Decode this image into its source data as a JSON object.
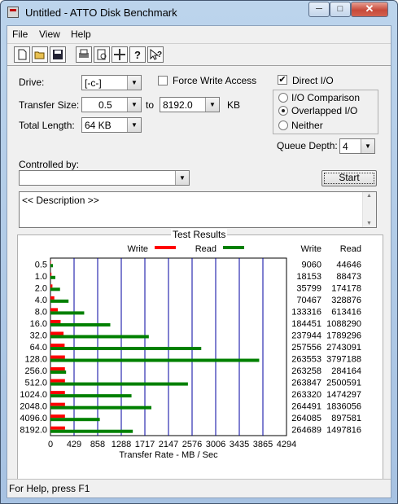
{
  "window": {
    "title": "Untitled - ATTO Disk Benchmark"
  },
  "titlebar": {
    "min_glyph": "─",
    "max_glyph": "□",
    "close_glyph": "✕"
  },
  "menu": [
    "File",
    "View",
    "Help"
  ],
  "toolbar_icons": [
    "new-document-icon",
    "open-folder-icon",
    "save-icon",
    "print-icon",
    "print-preview-icon",
    "move-icon",
    "help-icon",
    "context-help-icon"
  ],
  "drive": {
    "label": "Drive:",
    "value": "[-c-]"
  },
  "force_write": {
    "label": "Force Write Access",
    "checked": false
  },
  "direct_io": {
    "label": "Direct I/O",
    "checked": true
  },
  "transfer": {
    "label": "Transfer Size:",
    "from": "0.5",
    "to_label": "to",
    "to": "8192.0",
    "unit": "KB"
  },
  "total_length": {
    "label": "Total Length:",
    "value": "64 KB"
  },
  "io_mode": {
    "options": [
      "I/O Comparison",
      "Overlapped I/O",
      "Neither"
    ],
    "selected": "Overlapped I/O"
  },
  "queue_depth": {
    "label": "Queue Depth:",
    "value": "4"
  },
  "controlled_by": {
    "label": "Controlled by:",
    "value": ""
  },
  "start_button": "Start",
  "description": "<< Description >>",
  "results_title": "Test Results",
  "status": "For Help, press F1",
  "colors": {
    "write": "#ff0000",
    "read": "#008000",
    "grid": "#0000a0"
  },
  "chart_data": {
    "type": "bar",
    "orientation": "horizontal",
    "categories": [
      "0.5",
      "1.0",
      "2.0",
      "4.0",
      "8.0",
      "16.0",
      "32.0",
      "64.0",
      "128.0",
      "256.0",
      "512.0",
      "1024.0",
      "2048.0",
      "4096.0",
      "8192.0"
    ],
    "series": [
      {
        "name": "Write",
        "values": [
          9060,
          18153,
          35799,
          70467,
          133316,
          184451,
          237944,
          257556,
          263553,
          263258,
          263847,
          263320,
          264491,
          264085,
          264689
        ]
      },
      {
        "name": "Read",
        "values": [
          44646,
          88473,
          174178,
          328876,
          613416,
          1088290,
          1789296,
          2743091,
          3797188,
          284164,
          2500591,
          1474297,
          1836056,
          897581,
          1497816
        ]
      }
    ],
    "xlabel": "Transfer Rate - MB / Sec",
    "x_ticks": [
      "0",
      "429",
      "858",
      "1288",
      "1717",
      "2147",
      "2576",
      "3006",
      "3435",
      "3865",
      "4294"
    ],
    "xlim": [
      0,
      4294
    ],
    "value_scale_note": "bar length = value / 1000",
    "table_headers": [
      "Write",
      "Read"
    ],
    "legend": [
      "Write",
      "Read"
    ]
  }
}
